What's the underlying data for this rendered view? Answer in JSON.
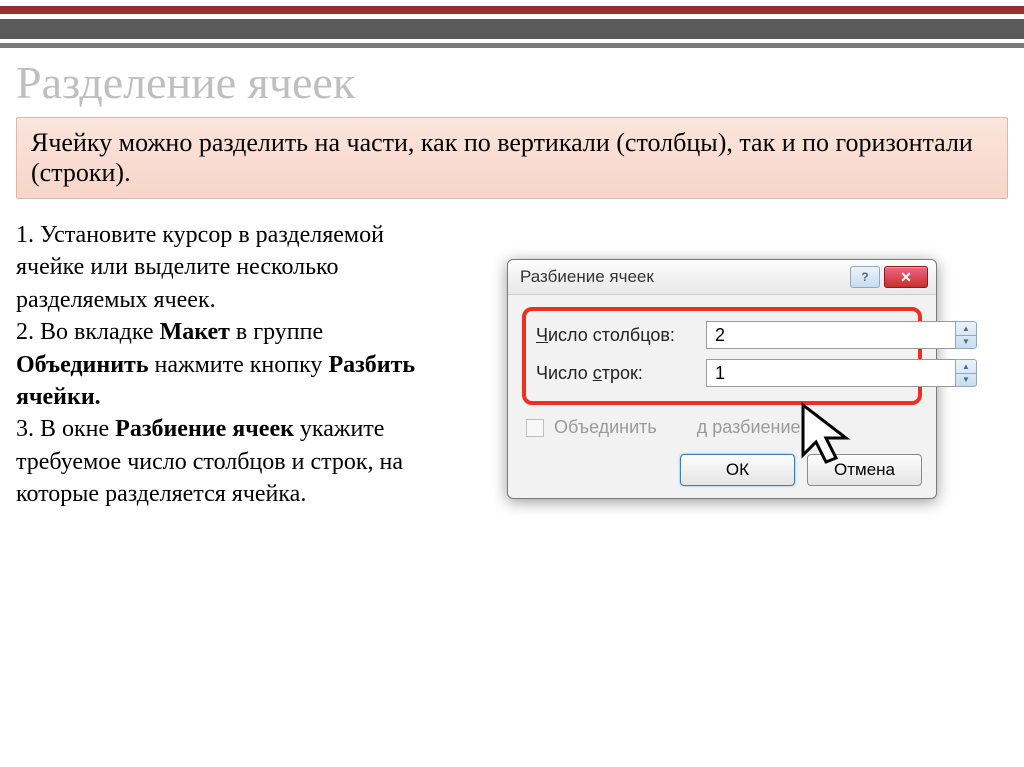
{
  "slide": {
    "title": "Разделение ячеек",
    "info": "Ячейку можно разделить на части, как по вертикали (столбцы), так и по горизонтали (строки).",
    "instructions": {
      "step1": "1. Установите курсор в разделяемой ячейке или выделите несколько разделяемых ячеек.",
      "step2_pre": "2. Во вкладке ",
      "step2_b1": "Макет",
      "step2_mid": " в группе ",
      "step2_b2": "Объединить",
      "step2_mid2": " нажмите кнопку ",
      "step2_b3": "Разбить ячейки.",
      "step3_pre": "3. В окне ",
      "step3_b1": "Разбиение ячеек",
      "step3_post": "  укажите требуемое число столбцов и строк, на которые разделяется ячейка."
    }
  },
  "dialog": {
    "title": "Разбиение ячеек",
    "help_symbol": "?",
    "close_symbol": "✕",
    "columns_label_u": "Ч",
    "columns_label_rest": "исло столбцов:",
    "columns_value": "2",
    "rows_label_pre": "Число ",
    "rows_label_u": "с",
    "rows_label_post": "трок:",
    "rows_value": "1",
    "merge_label_pre": "Объединить ",
    "merge_label_post": "д разбиением",
    "ok": "ОК",
    "cancel": "Отмена"
  }
}
